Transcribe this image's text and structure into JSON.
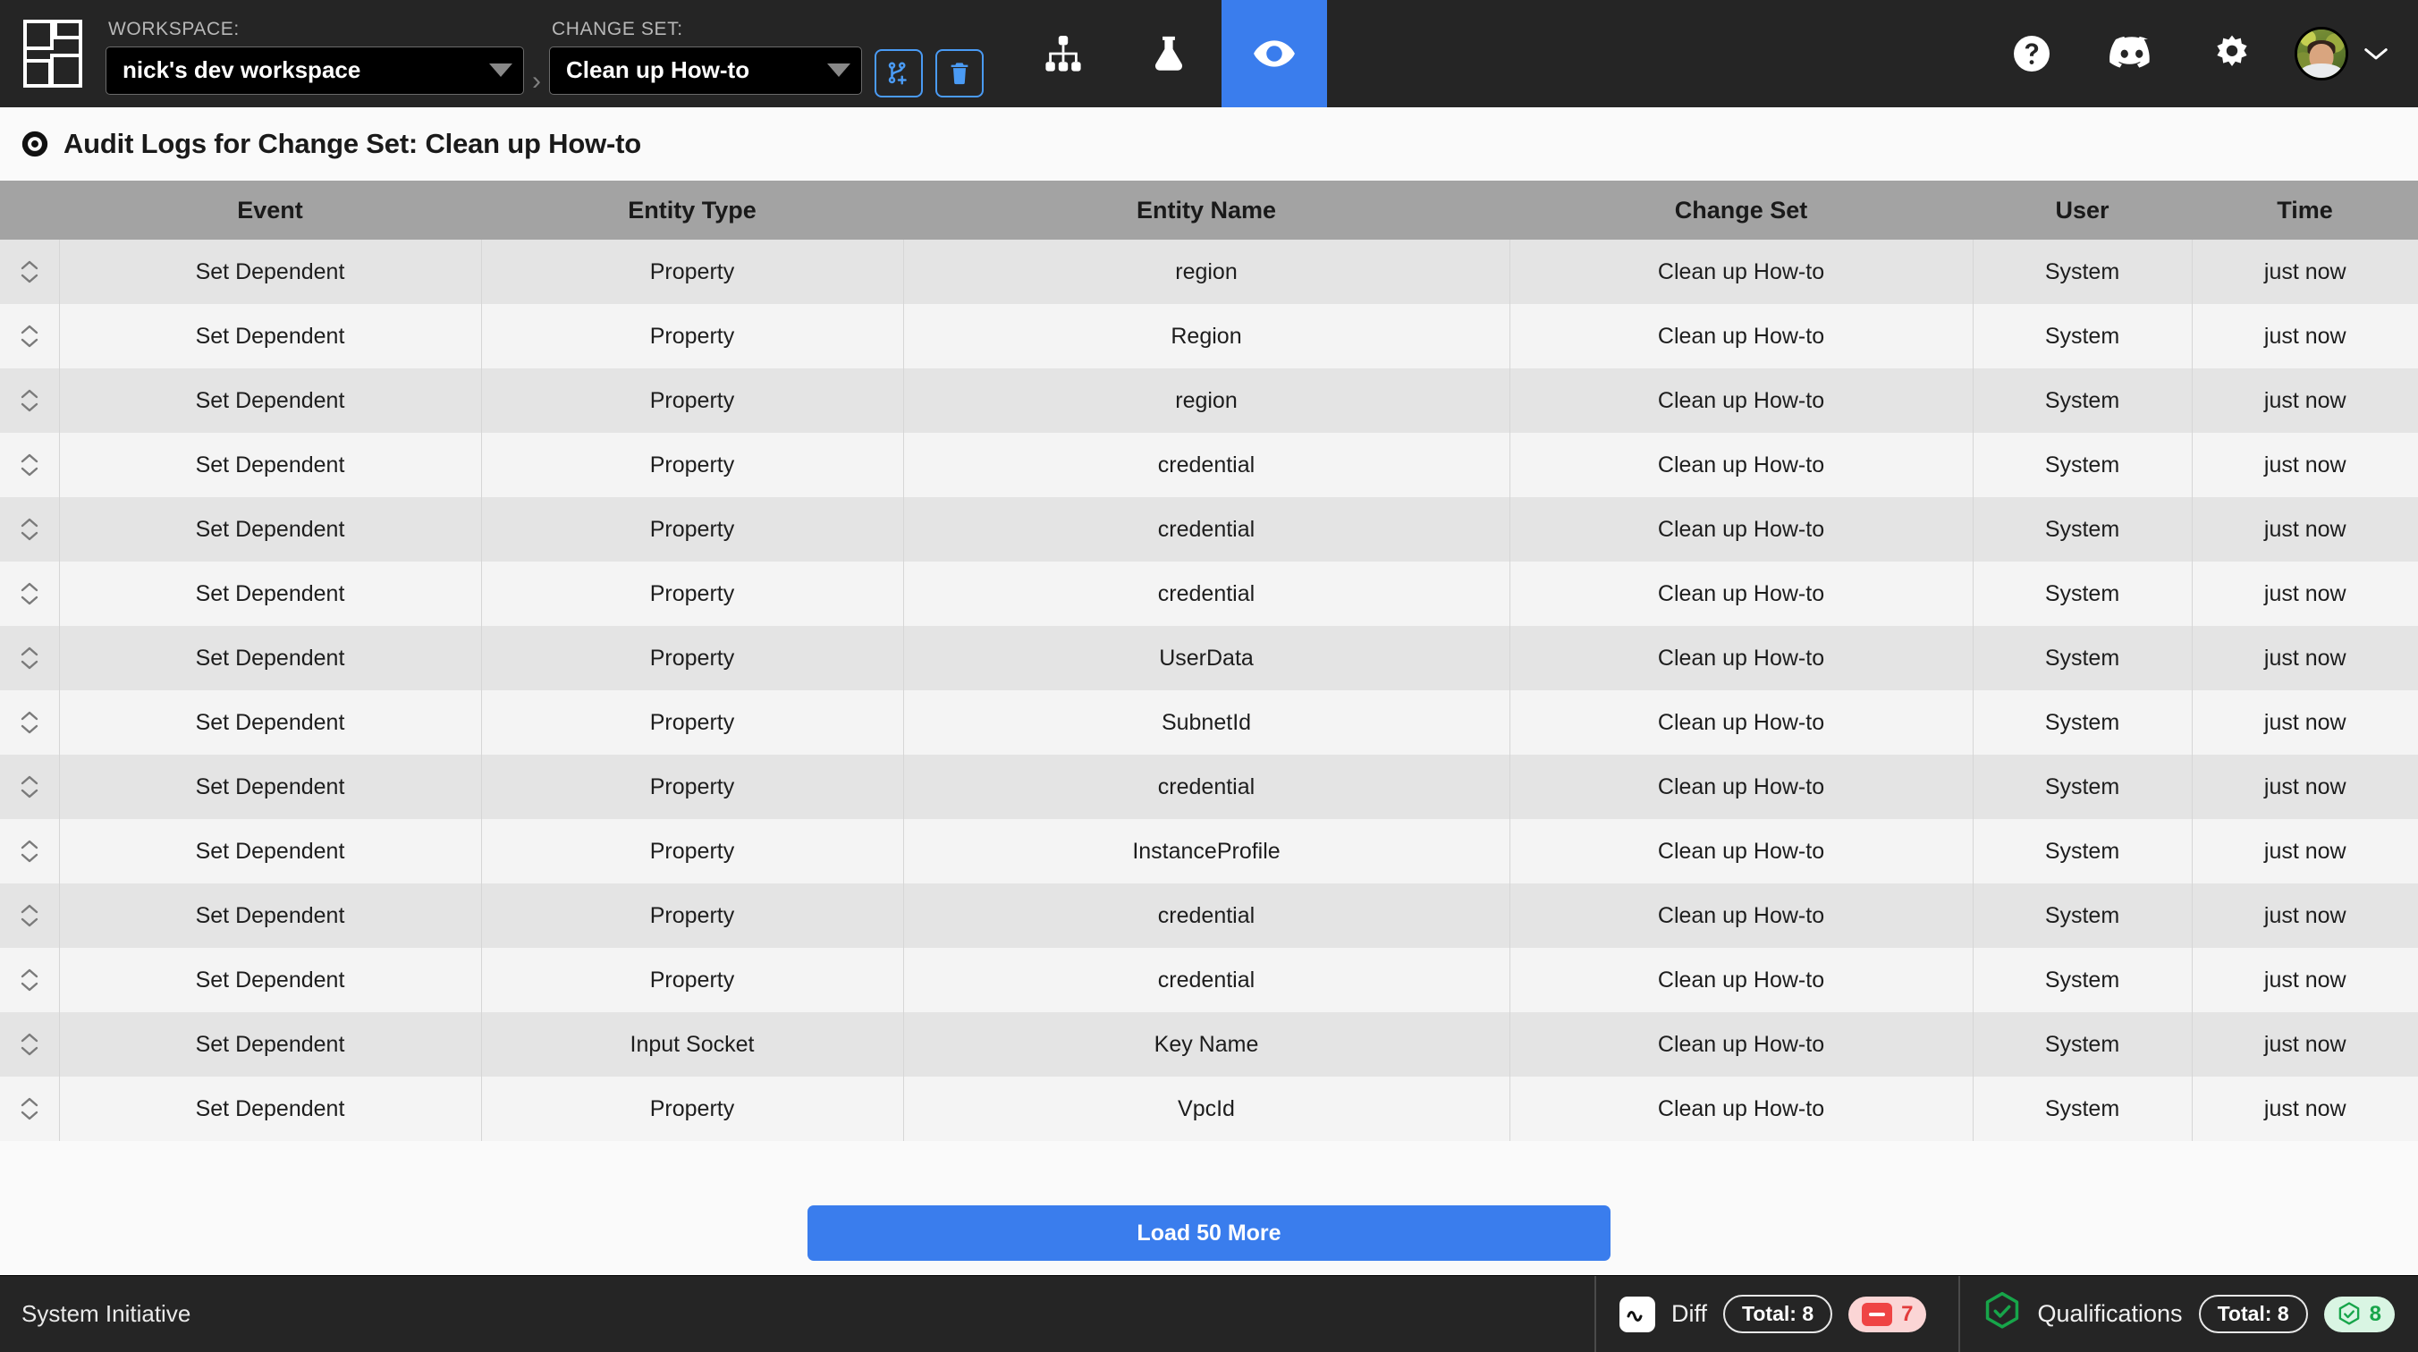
{
  "topbar": {
    "logo_name": "system-initiative-logo",
    "workspace": {
      "label": "WORKSPACE:",
      "value": "nick's dev workspace"
    },
    "breadcrumb_separator": "›",
    "changeset": {
      "label": "CHANGE SET:",
      "value": "Clean up How-to"
    },
    "actions": {
      "create_changeset": "create-change-set-button",
      "delete_changeset": "delete-change-set-button"
    },
    "nav": [
      {
        "name": "tab-model",
        "icon": "sitemap-icon",
        "active": false
      },
      {
        "name": "tab-lab",
        "icon": "flask-icon",
        "active": false
      },
      {
        "name": "tab-audit",
        "icon": "eye-icon",
        "active": true
      }
    ],
    "right": [
      {
        "name": "help-button",
        "icon": "question-circle-icon"
      },
      {
        "name": "discord-button",
        "icon": "discord-icon"
      },
      {
        "name": "settings-button",
        "icon": "gear-icon"
      },
      {
        "name": "profile-menu",
        "icon": "avatar"
      }
    ]
  },
  "page": {
    "icon": "eye-target-icon",
    "title": "Audit Logs for Change Set: Clean up How-to"
  },
  "table": {
    "columns": [
      "Event",
      "Entity Type",
      "Entity Name",
      "Change Set",
      "User",
      "Time"
    ],
    "rows": [
      {
        "event": "Set Dependent",
        "entity_type": "Property",
        "entity_name": "region",
        "change_set": "Clean up How-to",
        "user": "System",
        "time": "just now"
      },
      {
        "event": "Set Dependent",
        "entity_type": "Property",
        "entity_name": "Region",
        "change_set": "Clean up How-to",
        "user": "System",
        "time": "just now"
      },
      {
        "event": "Set Dependent",
        "entity_type": "Property",
        "entity_name": "region",
        "change_set": "Clean up How-to",
        "user": "System",
        "time": "just now"
      },
      {
        "event": "Set Dependent",
        "entity_type": "Property",
        "entity_name": "credential",
        "change_set": "Clean up How-to",
        "user": "System",
        "time": "just now"
      },
      {
        "event": "Set Dependent",
        "entity_type": "Property",
        "entity_name": "credential",
        "change_set": "Clean up How-to",
        "user": "System",
        "time": "just now"
      },
      {
        "event": "Set Dependent",
        "entity_type": "Property",
        "entity_name": "credential",
        "change_set": "Clean up How-to",
        "user": "System",
        "time": "just now"
      },
      {
        "event": "Set Dependent",
        "entity_type": "Property",
        "entity_name": "UserData",
        "change_set": "Clean up How-to",
        "user": "System",
        "time": "just now"
      },
      {
        "event": "Set Dependent",
        "entity_type": "Property",
        "entity_name": "SubnetId",
        "change_set": "Clean up How-to",
        "user": "System",
        "time": "just now"
      },
      {
        "event": "Set Dependent",
        "entity_type": "Property",
        "entity_name": "credential",
        "change_set": "Clean up How-to",
        "user": "System",
        "time": "just now"
      },
      {
        "event": "Set Dependent",
        "entity_type": "Property",
        "entity_name": "InstanceProfile",
        "change_set": "Clean up How-to",
        "user": "System",
        "time": "just now"
      },
      {
        "event": "Set Dependent",
        "entity_type": "Property",
        "entity_name": "credential",
        "change_set": "Clean up How-to",
        "user": "System",
        "time": "just now"
      },
      {
        "event": "Set Dependent",
        "entity_type": "Property",
        "entity_name": "credential",
        "change_set": "Clean up How-to",
        "user": "System",
        "time": "just now"
      },
      {
        "event": "Set Dependent",
        "entity_type": "Input Socket",
        "entity_name": "Key Name",
        "change_set": "Clean up How-to",
        "user": "System",
        "time": "just now"
      },
      {
        "event": "Set Dependent",
        "entity_type": "Property",
        "entity_name": "VpcId",
        "change_set": "Clean up How-to",
        "user": "System",
        "time": "just now"
      }
    ]
  },
  "load_more": {
    "label": "Load 50 More"
  },
  "statusbar": {
    "brand": "System Initiative",
    "diff": {
      "icon": "tilde-icon",
      "label": "Diff",
      "total": "Total:  8",
      "changed": "7"
    },
    "qualifications": {
      "icon": "hexagon-check-icon",
      "label": "Qualifications",
      "total": "Total:  8",
      "passed": "8"
    }
  },
  "colors": {
    "accent_blue": "#3a7ded",
    "icon_blue": "#4a9bf5",
    "header_gray": "#a3a3a3",
    "row_odd": "#e4e4e4",
    "row_even": "#f4f4f4",
    "topbar_dark": "#252525",
    "danger_red": "#ef4444",
    "success_green": "#17a54a"
  }
}
